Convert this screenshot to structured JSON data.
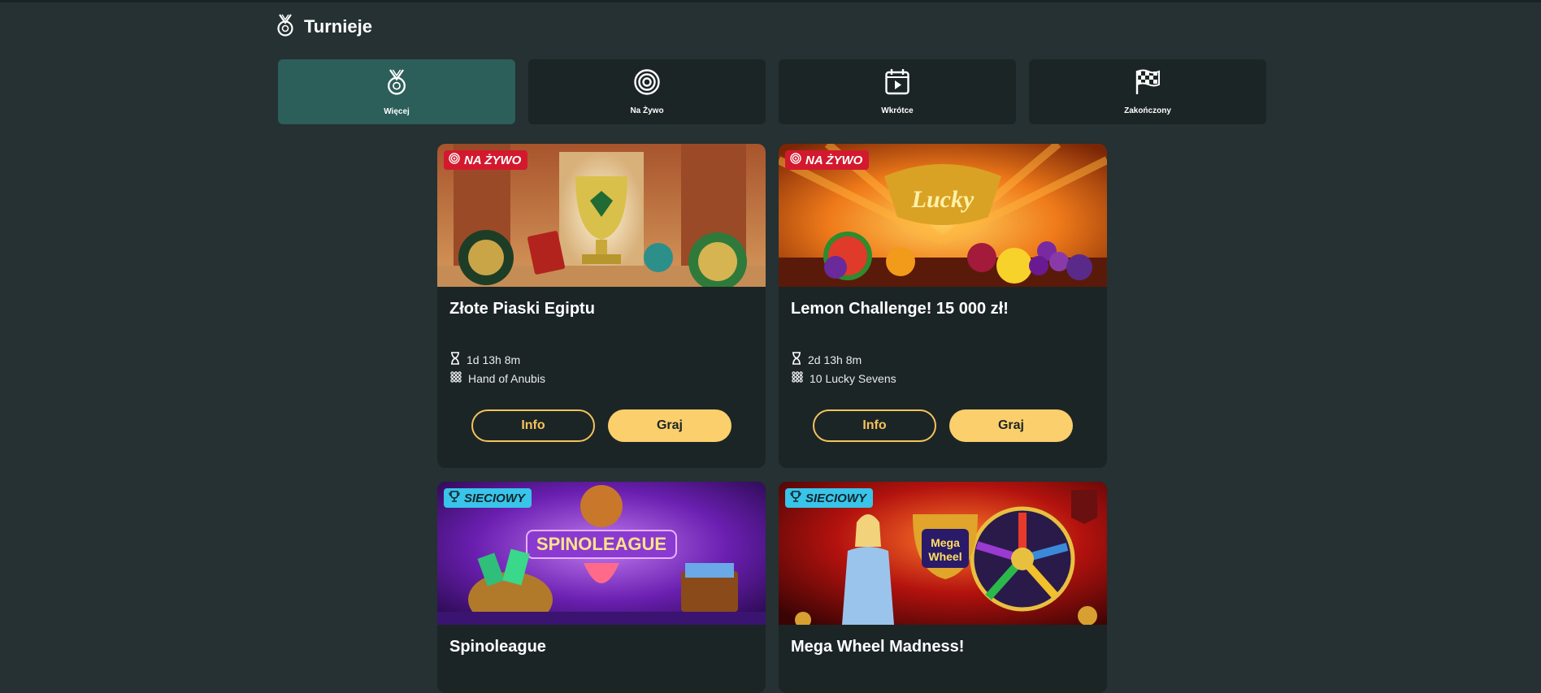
{
  "header": {
    "title": "Turnieje",
    "icon": "medal-icon"
  },
  "tabs": [
    {
      "label": "Więcej",
      "icon": "medal-icon",
      "active": true
    },
    {
      "label": "Na Żywo",
      "icon": "target-icon",
      "active": false
    },
    {
      "label": "Wkrótce",
      "icon": "calendar-play-icon",
      "active": false
    },
    {
      "label": "Zakończony",
      "icon": "checkered-flag-icon",
      "active": false
    }
  ],
  "cards": [
    {
      "badge": "NA ŻYWO",
      "badge_type": "live",
      "name": "Złote Piaski Egiptu",
      "time": "1d 13h 8m",
      "game": "Hand of Anubis",
      "info_label": "Info",
      "play_label": "Graj"
    },
    {
      "badge": "NA ŻYWO",
      "badge_type": "live",
      "name": "Lemon Challenge! 15 000 zł!",
      "time": "2d 13h 8m",
      "game": "10 Lucky Sevens",
      "info_label": "Info",
      "play_label": "Graj"
    },
    {
      "badge": "SIECIOWY",
      "badge_type": "network",
      "name": "Spinoleague"
    },
    {
      "badge": "SIECIOWY",
      "badge_type": "network",
      "name": "Mega Wheel Madness!"
    }
  ],
  "colors": {
    "background": "#253132",
    "card": "#1c2526",
    "active_tab": "#2c5e5a",
    "accent": "#fbcf6b",
    "live_badge": "#d3192e",
    "network_badge": "#39c4e9"
  }
}
